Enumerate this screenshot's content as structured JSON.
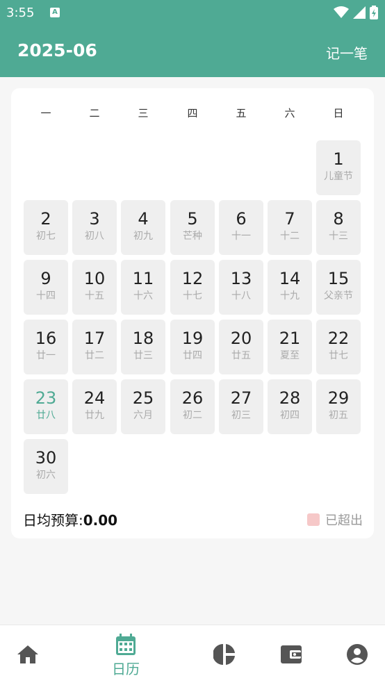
{
  "status_bar": {
    "time": "3:55",
    "notif_glyph": "A"
  },
  "header": {
    "title": "2025-06",
    "action_label": "记一笔"
  },
  "calendar": {
    "weekdays": [
      "一",
      "二",
      "三",
      "四",
      "五",
      "六",
      "日"
    ],
    "days": [
      {
        "num": "1",
        "sub": "儿童节"
      },
      {
        "num": "2",
        "sub": "初七"
      },
      {
        "num": "3",
        "sub": "初八"
      },
      {
        "num": "4",
        "sub": "初九"
      },
      {
        "num": "5",
        "sub": "芒种"
      },
      {
        "num": "6",
        "sub": "十一"
      },
      {
        "num": "7",
        "sub": "十二"
      },
      {
        "num": "8",
        "sub": "十三"
      },
      {
        "num": "9",
        "sub": "十四"
      },
      {
        "num": "10",
        "sub": "十五"
      },
      {
        "num": "11",
        "sub": "十六"
      },
      {
        "num": "12",
        "sub": "十七"
      },
      {
        "num": "13",
        "sub": "十八"
      },
      {
        "num": "14",
        "sub": "十九"
      },
      {
        "num": "15",
        "sub": "父亲节"
      },
      {
        "num": "16",
        "sub": "廿一"
      },
      {
        "num": "17",
        "sub": "廿二"
      },
      {
        "num": "18",
        "sub": "廿三"
      },
      {
        "num": "19",
        "sub": "廿四"
      },
      {
        "num": "20",
        "sub": "廿五"
      },
      {
        "num": "21",
        "sub": "夏至"
      },
      {
        "num": "22",
        "sub": "廿七"
      },
      {
        "num": "23",
        "sub": "廿八",
        "today": true
      },
      {
        "num": "24",
        "sub": "廿九"
      },
      {
        "num": "25",
        "sub": "六月"
      },
      {
        "num": "26",
        "sub": "初二"
      },
      {
        "num": "27",
        "sub": "初三"
      },
      {
        "num": "28",
        "sub": "初四"
      },
      {
        "num": "29",
        "sub": "初五"
      },
      {
        "num": "30",
        "sub": "初六"
      }
    ]
  },
  "budget": {
    "label": "日均预算:",
    "value": "0.00"
  },
  "legend": {
    "label": "已超出",
    "color": "#f6c8c8"
  },
  "bottom_nav": {
    "items": [
      {
        "icon": "home-icon",
        "label": ""
      },
      {
        "icon": "calendar-icon",
        "label": "日历",
        "active": true
      },
      {
        "icon": "pie-chart-icon",
        "label": ""
      },
      {
        "icon": "wallet-icon",
        "label": ""
      },
      {
        "icon": "account-icon",
        "label": ""
      }
    ]
  },
  "colors": {
    "accent": "#4faa94",
    "background": "#f6f6f6"
  }
}
